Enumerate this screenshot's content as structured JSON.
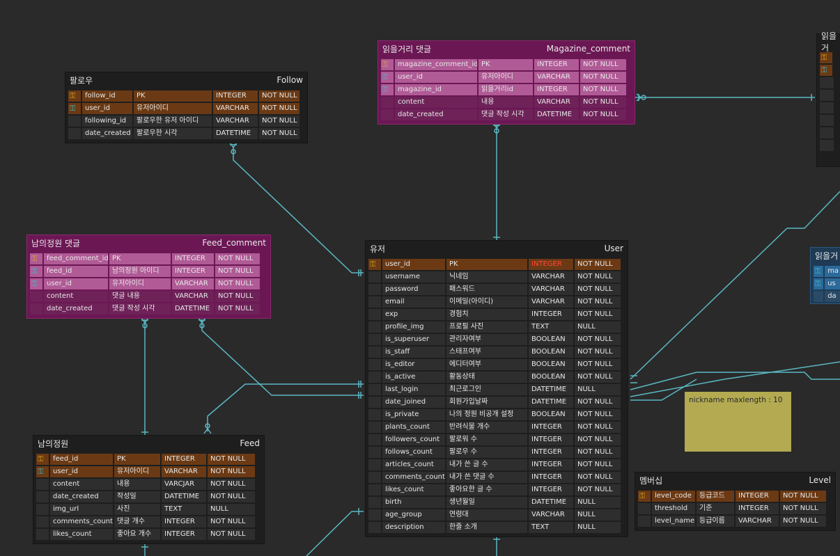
{
  "tables": {
    "follow": {
      "title_kr": "팔로우",
      "title_en": "Follow",
      "rows": [
        {
          "key": "pk",
          "name": "follow_id",
          "desc": "PK",
          "type": "INTEGER",
          "null": "NOT NULL"
        },
        {
          "key": "fk",
          "name": "user_id",
          "desc": "유저아이디",
          "type": "VARCHAR",
          "null": "NOT NULL"
        },
        {
          "key": "",
          "name": "following_id",
          "desc": "팔로우한 유저 아이디",
          "type": "VARCHAR",
          "null": "NOT NULL"
        },
        {
          "key": "",
          "name": "date_created",
          "desc": "팔로우한 시각",
          "type": "DATETIME",
          "null": "NOT NULL"
        }
      ]
    },
    "magazine_comment": {
      "title_kr": "읽을거리 댓글",
      "title_en": "Magazine_comment",
      "rows": [
        {
          "key": "pk",
          "name": "magazine_comment_id",
          "desc": "PK",
          "type": "INTEGER",
          "null": "NOT NULL"
        },
        {
          "key": "fk",
          "name": "user_id",
          "desc": "유저아이디",
          "type": "VARCHAR",
          "null": "NOT NULL"
        },
        {
          "key": "fk",
          "name": "magazine_id",
          "desc": "읽을거리id",
          "type": "INTEGER",
          "null": "NOT NULL"
        },
        {
          "key": "",
          "name": "content",
          "desc": "내용",
          "type": "VARCHAR",
          "null": "NOT NULL"
        },
        {
          "key": "",
          "name": "date_created",
          "desc": "댓글 작성 시각",
          "type": "DATETIME",
          "null": "NOT NULL"
        }
      ]
    },
    "feed_comment": {
      "title_kr": "남의정원 댓글",
      "title_en": "Feed_comment",
      "rows": [
        {
          "key": "pk",
          "name": "feed_comment_id",
          "desc": "PK",
          "type": "INTEGER",
          "null": "NOT NULL"
        },
        {
          "key": "fk",
          "name": "feed_id",
          "desc": "남의정원 아이디",
          "type": "INTEGER",
          "null": "NOT NULL"
        },
        {
          "key": "fk",
          "name": "user_id",
          "desc": "유저아이디",
          "type": "VARCHAR",
          "null": "NOT NULL"
        },
        {
          "key": "",
          "name": "content",
          "desc": "댓글 내용",
          "type": "VARCHAR",
          "null": "NOT NULL"
        },
        {
          "key": "",
          "name": "date_created",
          "desc": "댓글 작성 시각",
          "type": "DATETIME",
          "null": "NOT NULL"
        }
      ]
    },
    "feed": {
      "title_kr": "남의정원",
      "title_en": "Feed",
      "rows": [
        {
          "key": "pk",
          "name": "feed_id",
          "desc": "PK",
          "type": "INTEGER",
          "null": "NOT NULL"
        },
        {
          "key": "fk",
          "name": "user_id",
          "desc": "유저아이디",
          "type": "VARCHAR",
          "null": "NOT NULL"
        },
        {
          "key": "",
          "name": "content",
          "desc": "내용",
          "type": "VARCJAR",
          "null": "NOT NULL"
        },
        {
          "key": "",
          "name": "date_created",
          "desc": "작성일",
          "type": "DATETIME",
          "null": "NOT NULL"
        },
        {
          "key": "",
          "name": "img_url",
          "desc": "사진",
          "type": "TEXT",
          "null": "NULL"
        },
        {
          "key": "",
          "name": "comments_count",
          "desc": "댓글 개수",
          "type": "INTEGER",
          "null": "NOT NULL"
        },
        {
          "key": "",
          "name": "likes_count",
          "desc": "좋아요 개수",
          "type": "INTEGER",
          "null": "NOT NULL"
        }
      ]
    },
    "user": {
      "title_kr": "유저",
      "title_en": "User",
      "rows": [
        {
          "key": "pk",
          "name": "user_id",
          "desc": "PK",
          "type": "INTEGER",
          "null": "NOT NULL"
        },
        {
          "key": "",
          "name": "username",
          "desc": "닉네임",
          "type": "VARCHAR",
          "null": "NOT NULL"
        },
        {
          "key": "",
          "name": "password",
          "desc": "패스워드",
          "type": "VARCHAR",
          "null": "NOT NULL"
        },
        {
          "key": "",
          "name": "email",
          "desc": "이메일(아이디)",
          "type": "VARCHAR",
          "null": "NOT NULL"
        },
        {
          "key": "",
          "name": "exp",
          "desc": "경험치",
          "type": "INTEGER",
          "null": "NOT NULL"
        },
        {
          "key": "",
          "name": "profile_img",
          "desc": "프로필 사진",
          "type": "TEXT",
          "null": "NULL"
        },
        {
          "key": "",
          "name": "is_superuser",
          "desc": "관리자여부",
          "type": "BOOLEAN",
          "null": "NOT NULL"
        },
        {
          "key": "",
          "name": "is_staff",
          "desc": "스태프여부",
          "type": "BOOLEAN",
          "null": "NOT NULL"
        },
        {
          "key": "",
          "name": "is_editor",
          "desc": "에디터여부",
          "type": "BOOLEAN",
          "null": "NOT NULL"
        },
        {
          "key": "",
          "name": "is_active",
          "desc": "활동상태",
          "type": "BOOLEAN",
          "null": "NOT NULL"
        },
        {
          "key": "",
          "name": "last_login",
          "desc": "최근로그인",
          "type": "DATETIME",
          "null": "NULL"
        },
        {
          "key": "",
          "name": "date_joined",
          "desc": "회원가입날짜",
          "type": "DATETIME",
          "null": "NOT NULL"
        },
        {
          "key": "",
          "name": "is_private",
          "desc": "나의 정원 비공개 설정",
          "type": "BOOLEAN",
          "null": "NOT NULL"
        },
        {
          "key": "",
          "name": "plants_count",
          "desc": "반려식물 개수",
          "type": "INTEGER",
          "null": "NOT NULL"
        },
        {
          "key": "",
          "name": "followers_count",
          "desc": "팔로워 수",
          "type": "INTEGER",
          "null": "NOT NULL"
        },
        {
          "key": "",
          "name": "follows_count",
          "desc": "팔로우 수",
          "type": "INTEGER",
          "null": "NOT NULL"
        },
        {
          "key": "",
          "name": "articles_count",
          "desc": "내가 쓴 글 수",
          "type": "INTEGER",
          "null": "NOT NULL"
        },
        {
          "key": "",
          "name": "comments_count",
          "desc": "내가 쓴 댓글 수",
          "type": "INTEGER",
          "null": "NOT NULL"
        },
        {
          "key": "",
          "name": "likes_count",
          "desc": "좋아요한 글 수",
          "type": "INTEGER",
          "null": "NOT NULL"
        },
        {
          "key": "",
          "name": "birth",
          "desc": "생년월일",
          "type": "DATETIME",
          "null": "NULL"
        },
        {
          "key": "",
          "name": "age_group",
          "desc": "연령대",
          "type": "VARCHAR",
          "null": "NULL"
        },
        {
          "key": "",
          "name": "description",
          "desc": "한줄 소개",
          "type": "TEXT",
          "null": "NULL"
        }
      ]
    },
    "level": {
      "title_kr": "멤버십",
      "title_en": "Level",
      "rows": [
        {
          "key": "pk",
          "name": "level_code",
          "desc": "등급코드",
          "type": "INTEGER",
          "null": "NOT NULL"
        },
        {
          "key": "",
          "name": "threshold",
          "desc": "기준",
          "type": "INTEGER",
          "null": "NOT NULL"
        },
        {
          "key": "",
          "name": "level_name",
          "desc": "등급이름",
          "type": "VARCHAR",
          "null": "NOT NULL"
        }
      ]
    },
    "partial_magazine": {
      "title_kr": "읽을거"
    },
    "partial_blue": {
      "title_kr": "읽을거",
      "rows": [
        "ma",
        "us",
        "da"
      ]
    }
  },
  "note": {
    "text": "nickname maxlength : 10"
  },
  "colors": {
    "line": "#5ab8c4",
    "pk_key": "#e0b020",
    "fk_key": "#40c0d0",
    "user_pk_type": "#ff4a3a"
  }
}
